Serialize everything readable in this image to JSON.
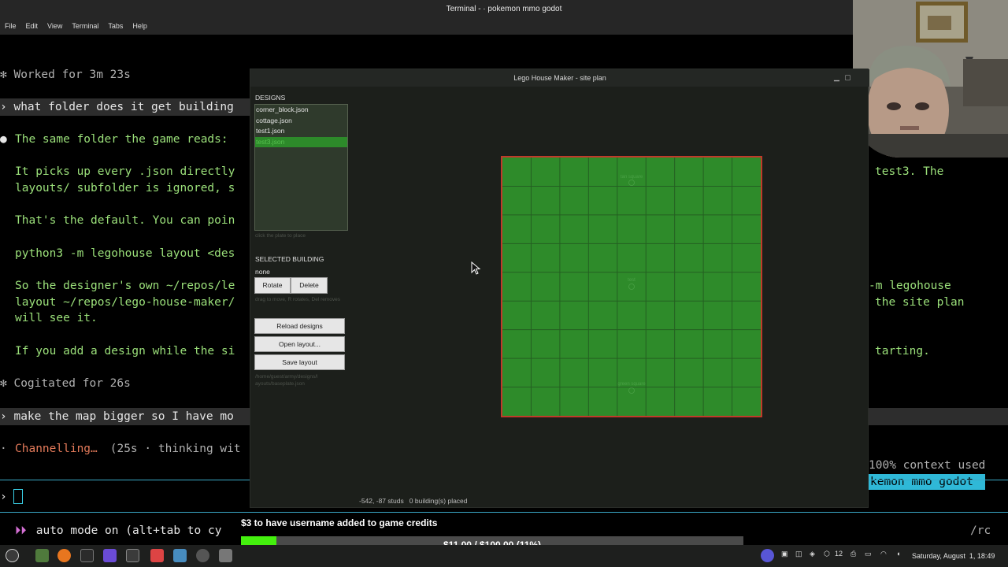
{
  "terminal": {
    "title": "Terminal - · pokemon mmo godot",
    "menu": [
      "File",
      "Edit",
      "View",
      "Terminal",
      "Tabs",
      "Help"
    ],
    "lines": {
      "worked": "✻ Worked for 3m 23s",
      "prompt1": "› what folder does it get building",
      "bullet": "●",
      "answer1": "The same folder the game reads:",
      "para1a": "It picks up every .json directly",
      "para1a_tail": "test3. The",
      "para1b": "layouts/ subfolder is ignored, s",
      "para2": "That's the default. You can poin",
      "cmd": "python3 -m legohouse layout <des",
      "para3a": "So the designer's own ~/repos/le",
      "para3a_tail": "-m legohouse",
      "para3b": "layout ~/repos/lego-house-maker/",
      "para3b_tail": "the site plan",
      "para3c": "will see it.",
      "para4": "If you add a design while the si",
      "para4_tail": "tarting.",
      "cogitated": "✻ Cogitated for 26s",
      "prompt2": "› make the map bigger so I have mo",
      "channelling_dot": "·",
      "channelling": "Channelling…",
      "channelling_rest": " (25s · thinking wit",
      "prompt_symbol": "›",
      "auto_arrows": "⏵⏵",
      "auto_mode": " auto mode on (alt+tab to cy",
      "rc": "/rc"
    },
    "context_used": "100% context used",
    "project_badge": "kemon mmo godot"
  },
  "lego_window": {
    "title": "Lego House Maker - site plan",
    "designs_label": "DESIGNS",
    "designs": [
      "corner_block.json",
      "cottage.json",
      "test1.json",
      "test3.json"
    ],
    "selected_design": "test3.json",
    "design_hint": "click the plate to place",
    "selected_building_label": "SELECTED BUILDING",
    "selected_building_value": "none",
    "rotate_label": "Rotate",
    "delete_label": "Delete",
    "building_hint": "drag to move, R rotates, Del removes",
    "reload_label": "Reload designs",
    "open_layout_label": "Open layout...",
    "save_layout_label": "Save layout",
    "layout_path_line1": "/home/guest/army/designs/l",
    "layout_path_line2": "ayouts/baseplate.json",
    "plate_labels": [
      "tan square",
      "test",
      "green square"
    ],
    "status_coords": "-542, -87 studs",
    "status_count": "0 building(s) placed",
    "plate_color": "#2e8b2a",
    "plate_border_color": "#c03a2a"
  },
  "donation": {
    "title": "$3 to have username added to game credits",
    "progress_text": "$11.00 / $100.00 (11%)",
    "progress_fraction": 0.11,
    "fill_color": "#44f00e"
  },
  "taskbar": {
    "tray_number": "12",
    "clock": "Saturday, August  1, 18:49"
  }
}
